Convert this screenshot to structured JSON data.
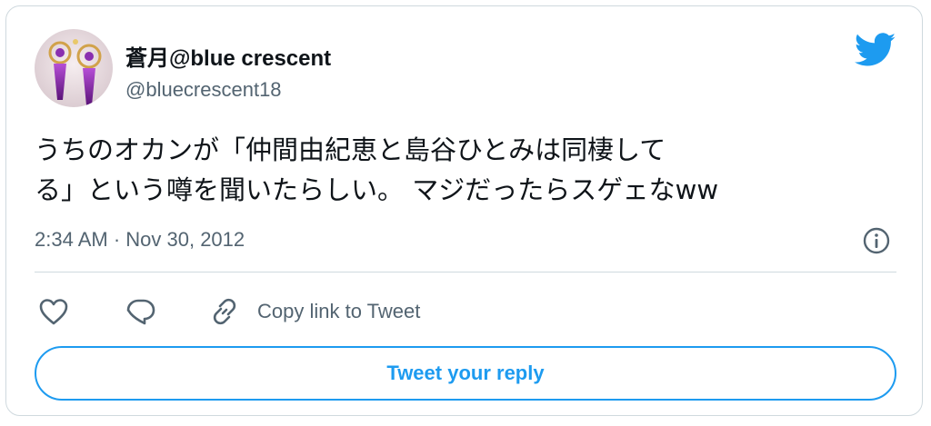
{
  "colors": {
    "accent": "#1d9bf0",
    "text_primary": "#0f1419",
    "text_secondary": "#536471",
    "border": "#cfd9de"
  },
  "author": {
    "display_name": "蒼月@blue crescent",
    "handle": "@bluecrescent18",
    "avatar_icon": "avatar-earrings-photo"
  },
  "brand_icon": "twitter-bird-icon",
  "tweet": {
    "text_lines": [
      "うちのオカンが「仲間由紀恵と島谷ひとみは同棲して",
      "る」という噂を聞いたらしい。 マジだったらスゲェなww"
    ],
    "timestamp": "2:34 AM · Nov 30, 2012"
  },
  "actions": {
    "like_icon": "heart-icon",
    "reply_icon": "reply-bubble-icon",
    "copy_link_icon": "link-icon",
    "copy_link_label": "Copy link to Tweet",
    "info_icon": "info-icon"
  },
  "reply_button": {
    "label": "Tweet your reply"
  }
}
